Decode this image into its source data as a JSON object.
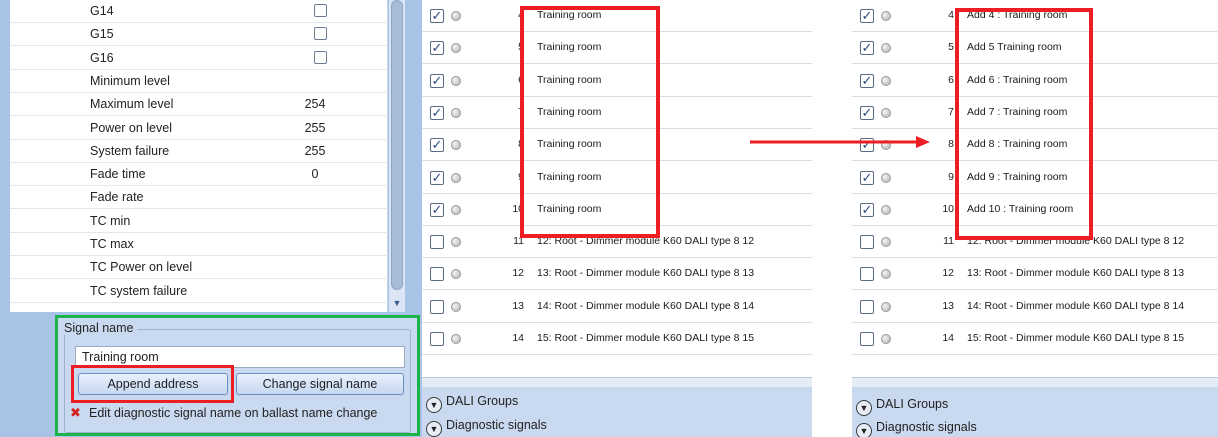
{
  "properties": [
    {
      "label": "G14",
      "value": "",
      "checkbox": true
    },
    {
      "label": "G15",
      "value": "",
      "checkbox": true
    },
    {
      "label": "G16",
      "value": "",
      "checkbox": true
    },
    {
      "label": "Minimum level",
      "value": ""
    },
    {
      "label": "Maximum level",
      "value": "254"
    },
    {
      "label": "Power on level",
      "value": "255"
    },
    {
      "label": "System failure",
      "value": "255"
    },
    {
      "label": "Fade time",
      "value": "0"
    },
    {
      "label": "Fade rate",
      "value": ""
    },
    {
      "label": "TC min",
      "value": ""
    },
    {
      "label": "TC max",
      "value": ""
    },
    {
      "label": "TC Power on level",
      "value": ""
    },
    {
      "label": "TC system failure",
      "value": ""
    }
  ],
  "signal_name": {
    "title": "Signal name",
    "input_value": "Training room",
    "append_label": "Append address",
    "change_label": "Change signal name",
    "edit_diag_label": "Edit diagnostic signal name on ballast name change",
    "edit_diag_icon": "red-x-icon"
  },
  "list_before": [
    {
      "checked": true,
      "num": "4",
      "name": "Training room"
    },
    {
      "checked": true,
      "num": "5",
      "name": "Training room"
    },
    {
      "checked": true,
      "num": "6",
      "name": "Training room"
    },
    {
      "checked": true,
      "num": "7",
      "name": "Training room"
    },
    {
      "checked": true,
      "num": "8",
      "name": "Training room"
    },
    {
      "checked": true,
      "num": "9",
      "name": "Training room"
    },
    {
      "checked": true,
      "num": "10",
      "name": "Training room"
    },
    {
      "checked": false,
      "num": "11",
      "name": "12: Root - Dimmer module K60  DALI type 8 12"
    },
    {
      "checked": false,
      "num": "12",
      "name": "13: Root - Dimmer module K60  DALI type 8 13"
    },
    {
      "checked": false,
      "num": "13",
      "name": "14: Root - Dimmer module K60  DALI type 8 14"
    },
    {
      "checked": false,
      "num": "14",
      "name": "15: Root - Dimmer module K60  DALI type 8 15"
    }
  ],
  "list_after": [
    {
      "checked": true,
      "num": "4",
      "name": "Add 4 : Training room"
    },
    {
      "checked": true,
      "num": "5",
      "name": "Add  5  Training room"
    },
    {
      "checked": true,
      "num": "6",
      "name": "Add 6 : Training room"
    },
    {
      "checked": true,
      "num": "7",
      "name": "Add 7 : Training room"
    },
    {
      "checked": true,
      "num": "8",
      "name": "Add 8 : Training room"
    },
    {
      "checked": true,
      "num": "9",
      "name": "Add 9 : Training room"
    },
    {
      "checked": true,
      "num": "10",
      "name": "Add 10 : Training room"
    },
    {
      "checked": false,
      "num": "11",
      "name": "12: Root - Dimmer module K60  DALI type 8 12"
    },
    {
      "checked": false,
      "num": "12",
      "name": "13: Root - Dimmer module K60  DALI type 8 13"
    },
    {
      "checked": false,
      "num": "13",
      "name": "14: Root - Dimmer module K60  DALI type 8 14"
    },
    {
      "checked": false,
      "num": "14",
      "name": "15: Root - Dimmer module K60  DALI type 8 15"
    }
  ],
  "groups": {
    "dali_groups": "DALI Groups",
    "diagnostic_signals": "Diagnostic signals"
  },
  "colors": {
    "highlight_red": "#ee1c23",
    "highlight_green": "#1bb34a",
    "panel_blue": "#c9d9ef"
  }
}
